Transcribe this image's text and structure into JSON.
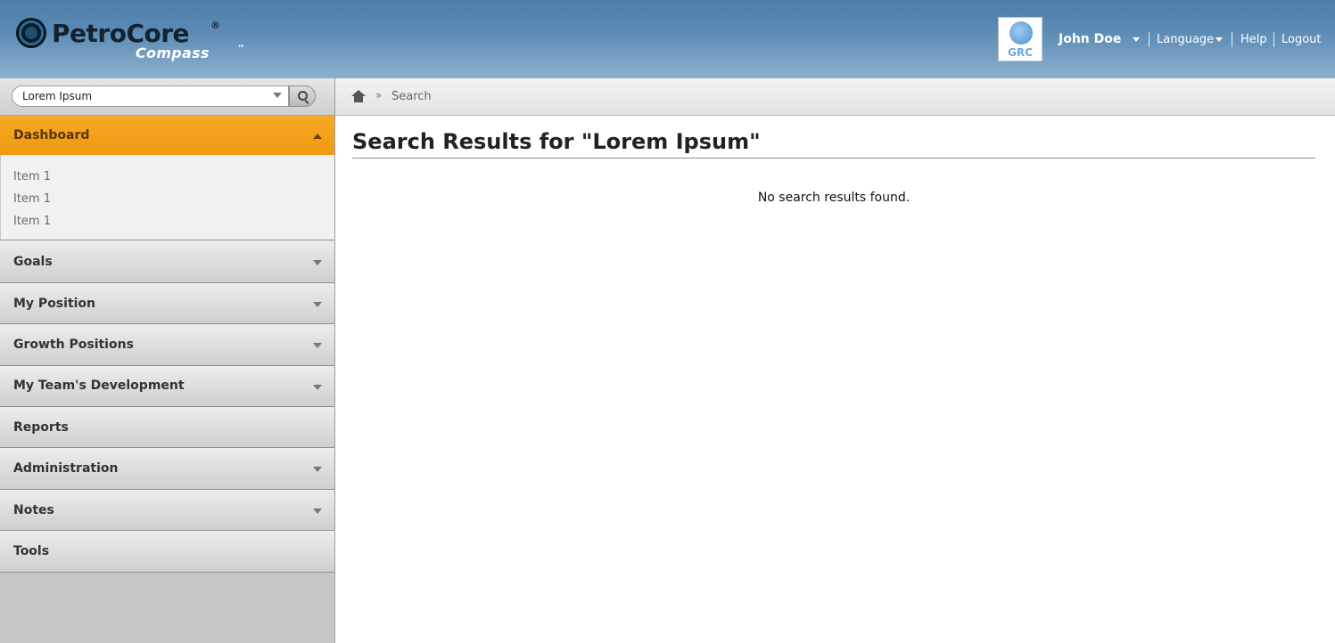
{
  "brand": {
    "name": "PetroCore",
    "registered": "®",
    "product": "Compass",
    "trademark": "™"
  },
  "header": {
    "org_badge": "GRC",
    "user_name": "John Doe",
    "links": {
      "language": "Language",
      "help": "Help",
      "logout": "Logout"
    }
  },
  "search": {
    "value": "Lorem Ipsum"
  },
  "sidebar": {
    "dashboard": {
      "label": "Dashboard",
      "items": [
        "Item 1",
        "Item 1",
        "Item 1"
      ]
    },
    "items": [
      {
        "label": "Goals"
      },
      {
        "label": "My Position"
      },
      {
        "label": "Growth Positions"
      },
      {
        "label": "My Team's Development"
      },
      {
        "label": "Reports"
      },
      {
        "label": "Administration"
      },
      {
        "label": "Notes"
      },
      {
        "label": "Tools"
      }
    ]
  },
  "breadcrumb": {
    "separator": "»",
    "current": "Search"
  },
  "main": {
    "title": "Search Results for \"Lorem Ipsum\"",
    "empty_message": "No search results found."
  },
  "colors": {
    "header": "#5b8bb4",
    "active_nav": "#f6a826",
    "sidebar": "#c8c8c8"
  },
  "icons": [
    "logo-icon",
    "globe-icon",
    "chevron-down-icon",
    "chevron-up-icon",
    "search-icon",
    "home-icon"
  ]
}
